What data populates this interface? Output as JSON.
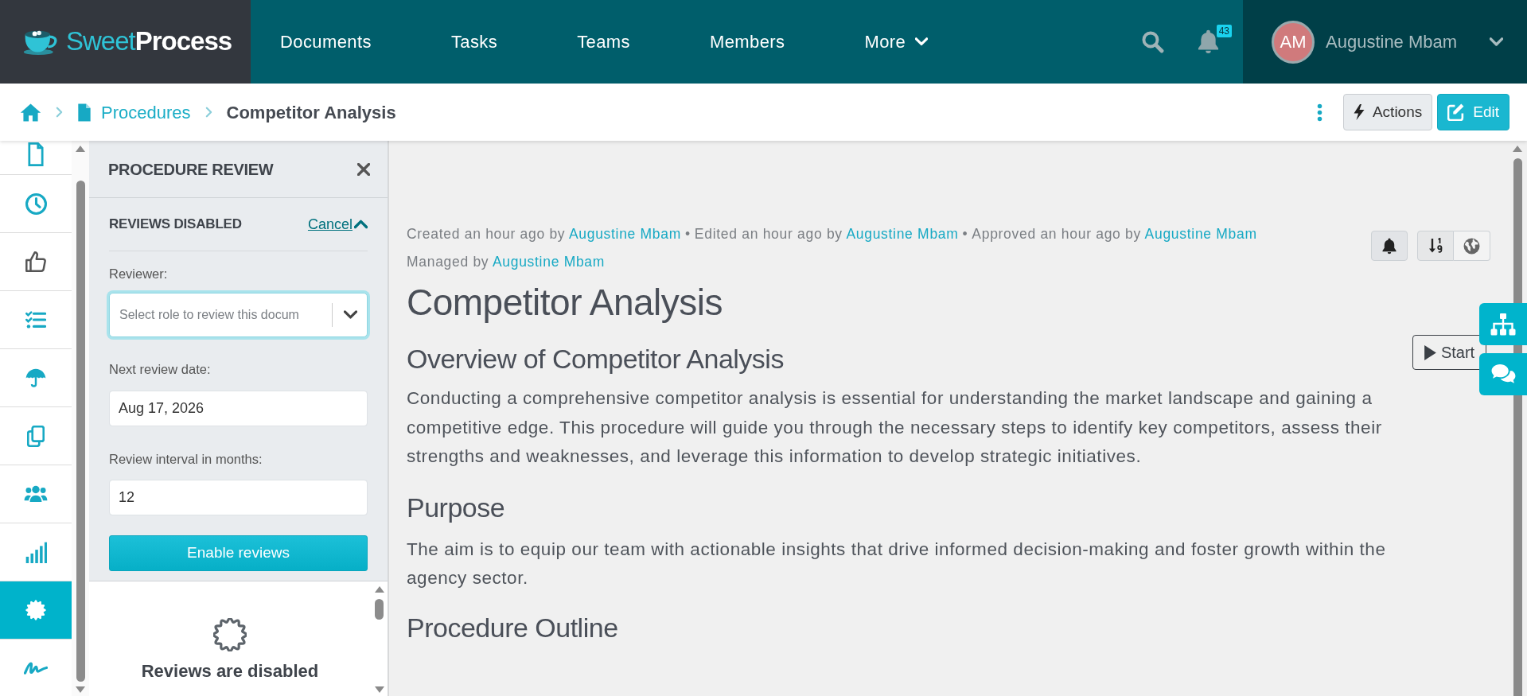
{
  "header": {
    "logo": "Sweet**Process**",
    "nav": [
      {
        "label": "Documents",
        "dropdown": false
      },
      {
        "label": "Tasks",
        "dropdown": false
      },
      {
        "label": "Teams",
        "dropdown": false
      },
      {
        "label": "Members",
        "dropdown": false
      },
      {
        "label": "More",
        "dropdown": true
      }
    ],
    "notification_count": "43",
    "user": {
      "initials": "AM",
      "name": "Augustine Mbam"
    }
  },
  "breadcrumb": {
    "items": [
      {
        "label": "Procedures",
        "current": false
      },
      {
        "label": "Competitor Analysis",
        "current": true
      }
    ],
    "buttons": [
      {
        "label": "Actions",
        "kind": "secondary"
      },
      {
        "label": "Edit",
        "kind": "primary"
      }
    ]
  },
  "sidebar": {
    "items": [
      {
        "selected": false
      },
      {
        "selected": false
      },
      {
        "selected": false
      },
      {
        "selected": false
      },
      {
        "selected": false
      },
      {
        "selected": false
      },
      {
        "selected": false
      },
      {
        "selected": false
      },
      {
        "selected": true
      },
      {
        "selected": false
      }
    ]
  },
  "review_panel": {
    "title": "PROCEDURE REVIEW",
    "status": "REVIEWS DISABLED",
    "cancel": "Cancel",
    "expanded": true,
    "fields": [
      {
        "label": "Reviewer:",
        "kind": "select",
        "placeholder": "Select role to review this docum",
        "focused": true
      },
      {
        "label": "Next review date:",
        "kind": "text",
        "value": "Aug 17, 2026",
        "focused": false
      },
      {
        "label": "Review interval in months:",
        "kind": "text",
        "value": "12",
        "focused": false
      }
    ],
    "submit": "Enable reviews",
    "empty_state": "Reviews are disabled"
  },
  "document": {
    "meta": [
      {
        "text": "Created an hour ago by",
        "user": "Augustine Mbam"
      },
      {
        "text": "Edited an hour ago by",
        "user": "Augustine Mbam"
      },
      {
        "text": "Approved an hour ago by",
        "user": "Augustine Mbam"
      }
    ],
    "meta_separator": "•",
    "managed": {
      "text": "Managed by",
      "user": "Augustine Mbam"
    },
    "title": "Competitor Analysis",
    "sections": [
      {
        "heading": "Overview of Competitor Analysis",
        "body": "Conducting a comprehensive competitor analysis is essential for understanding the market landscape and gaining a competitive edge. This procedure will guide you through the necessary steps to identify key competitors, assess their strengths and weaknesses, and leverage this information to develop strategic initiatives."
      },
      {
        "heading": "Purpose",
        "body": "The aim is to equip our team with actionable insights that drive informed decision-making and foster growth within the agency sector."
      },
      {
        "heading": "Procedure Outline"
      }
    ],
    "start_button": "Start"
  }
}
